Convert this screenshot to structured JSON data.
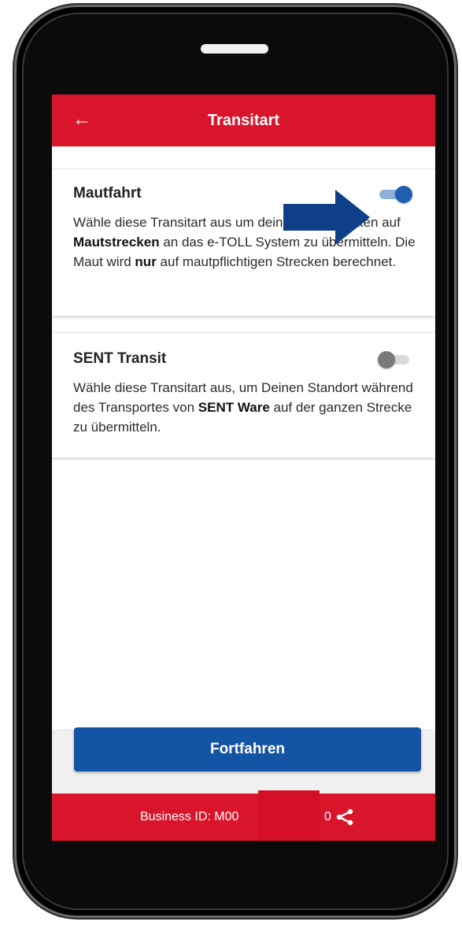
{
  "appbar": {
    "back_icon": "arrow-left-icon",
    "title": "Transitart"
  },
  "options": [
    {
      "title": "Mautfahrt",
      "enabled": true,
      "desc_1": "Wähle diese Transitart aus um deine Standortdaten auf ",
      "desc_bold_1": "Mautstrecken",
      "desc_2": " an das e-TOLL System zu übermitteln. Die Maut wird ",
      "desc_bold_2": "nur",
      "desc_3": " auf mautpflichtigen Strecken berechnet."
    },
    {
      "title": "SENT Transit",
      "enabled": false,
      "desc_1": "Wähle diese Transitart aus, um Deinen Standort während des Transportes von ",
      "desc_bold_1": "SENT Ware",
      "desc_2": " auf der ganzen Strecke zu übermitteln."
    }
  ],
  "continue_label": "Fortfahren",
  "footer": {
    "business_id_label": "Business ID:  M00",
    "business_id_suffix": "0",
    "share_icon": "share-icon"
  },
  "colors": {
    "brand_red": "#d9152b",
    "primary_blue": "#1454a4",
    "annotation_arrow": "#0f3f86"
  }
}
